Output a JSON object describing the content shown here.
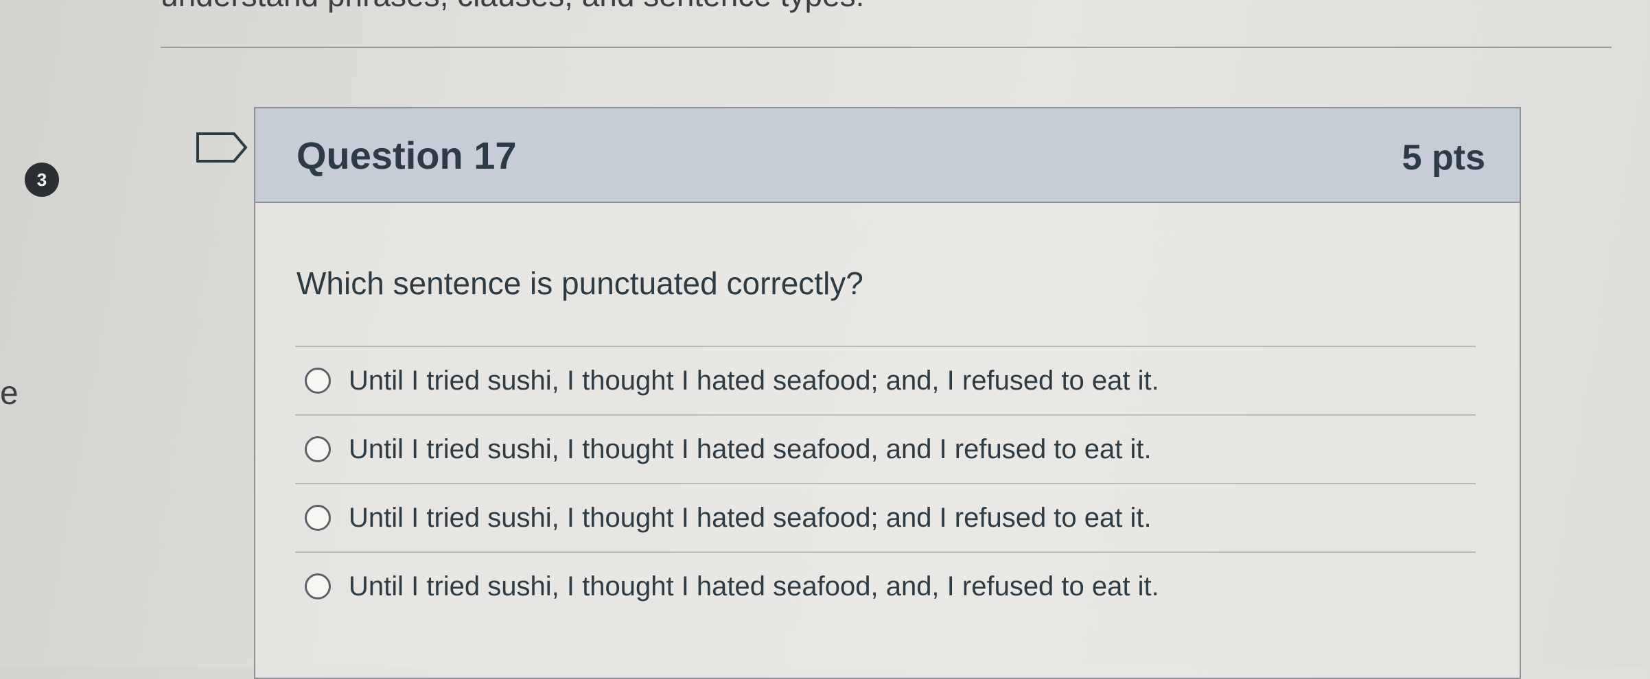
{
  "page": {
    "top_text": "understand phrases, clauses, and sentence types.",
    "step_badge": "3",
    "side_letter": "e"
  },
  "question": {
    "title": "Question 17",
    "points": "5 pts",
    "prompt": "Which sentence is punctuated correctly?",
    "answers": [
      {
        "label": "Until I tried sushi, I thought I hated seafood; and, I refused to eat it.",
        "selected": false
      },
      {
        "label": "Until I tried sushi, I thought I hated seafood, and I refused to eat it.",
        "selected": false
      },
      {
        "label": "Until I tried sushi, I thought I hated seafood; and I refused to eat it.",
        "selected": false
      },
      {
        "label": "Until I tried sushi, I thought I hated seafood, and, I refused to eat it.",
        "selected": false
      }
    ]
  },
  "icons": {
    "flag": "bookmark-flag-icon",
    "radio": "radio-unselected-icon"
  },
  "colors": {
    "header_bg": "#c7cdd6",
    "text": "#2d3b45",
    "border": "#8f9398"
  }
}
